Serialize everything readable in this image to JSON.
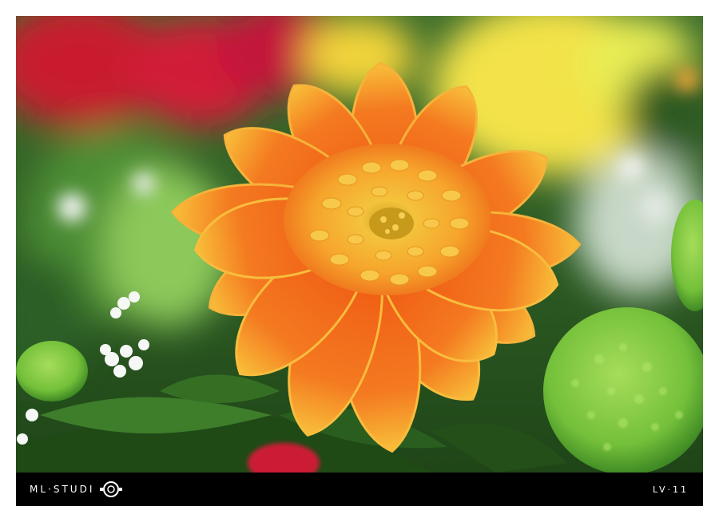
{
  "caption": {
    "brand_text": "ML·STUDI",
    "code": "LV·11"
  },
  "icons": {
    "brand_logo": "aperture-ring-icon"
  },
  "colors": {
    "caption_bg": "#000000",
    "caption_text": "#ffffff",
    "frame_bg": "#ffffff",
    "petal_orange": "#f26a1b",
    "petal_yellow": "#f5b52a",
    "center_yellow": "#f6c03a",
    "foliage_green": "#5fa83a",
    "bloom_green": "#8fd04a",
    "blur_red": "#c81d2d",
    "blur_yellow": "#f3e24a"
  }
}
